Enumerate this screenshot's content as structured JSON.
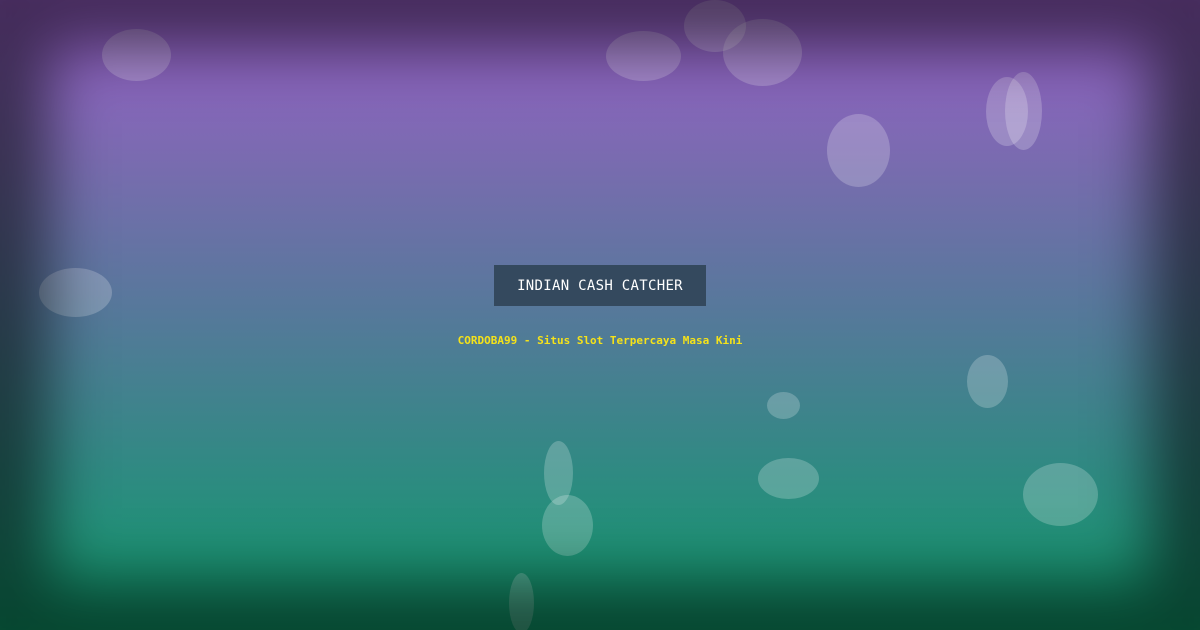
{
  "banner": {
    "title": "INDIAN CASH CATCHER",
    "subtitle": "CORDOBA99 - Situs Slot Terpercaya Masa Kini"
  },
  "colors": {
    "gradient_top": "#9860c9",
    "gradient_bottom": "#0f9a6a",
    "title_box_bg": "#34495e",
    "title_text": "#ffffff",
    "subtitle_text": "#f5e21a"
  }
}
